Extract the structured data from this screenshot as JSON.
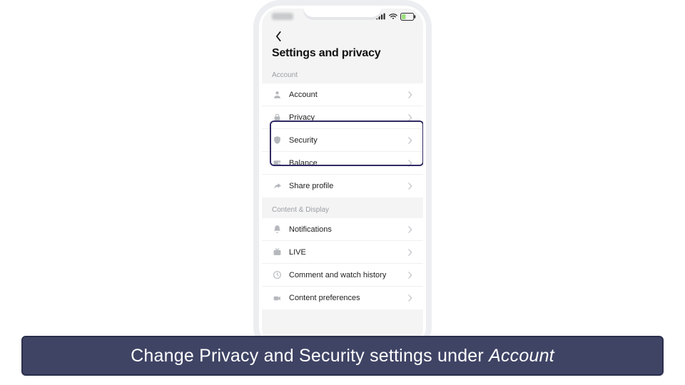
{
  "colors": {
    "highlight": "#2f2a63",
    "caption_bg": "#3f4465",
    "caption_border": "#2b2e4a"
  },
  "page": {
    "title": "Settings and privacy"
  },
  "sections": {
    "account": {
      "header": "Account",
      "items": [
        {
          "icon": "person-icon",
          "label": "Account"
        },
        {
          "icon": "lock-icon",
          "label": "Privacy"
        },
        {
          "icon": "shield-icon",
          "label": "Security"
        },
        {
          "icon": "wallet-icon",
          "label": "Balance"
        },
        {
          "icon": "share-icon",
          "label": "Share profile"
        }
      ]
    },
    "content": {
      "header": "Content & Display",
      "items": [
        {
          "icon": "bell-icon",
          "label": "Notifications"
        },
        {
          "icon": "live-icon",
          "label": "LIVE"
        },
        {
          "icon": "clock-icon",
          "label": "Comment and watch history"
        },
        {
          "icon": "video-icon",
          "label": "Content preferences"
        }
      ]
    }
  },
  "caption": {
    "prefix": "Change Privacy and Security settings under ",
    "emphasis": "Account"
  }
}
